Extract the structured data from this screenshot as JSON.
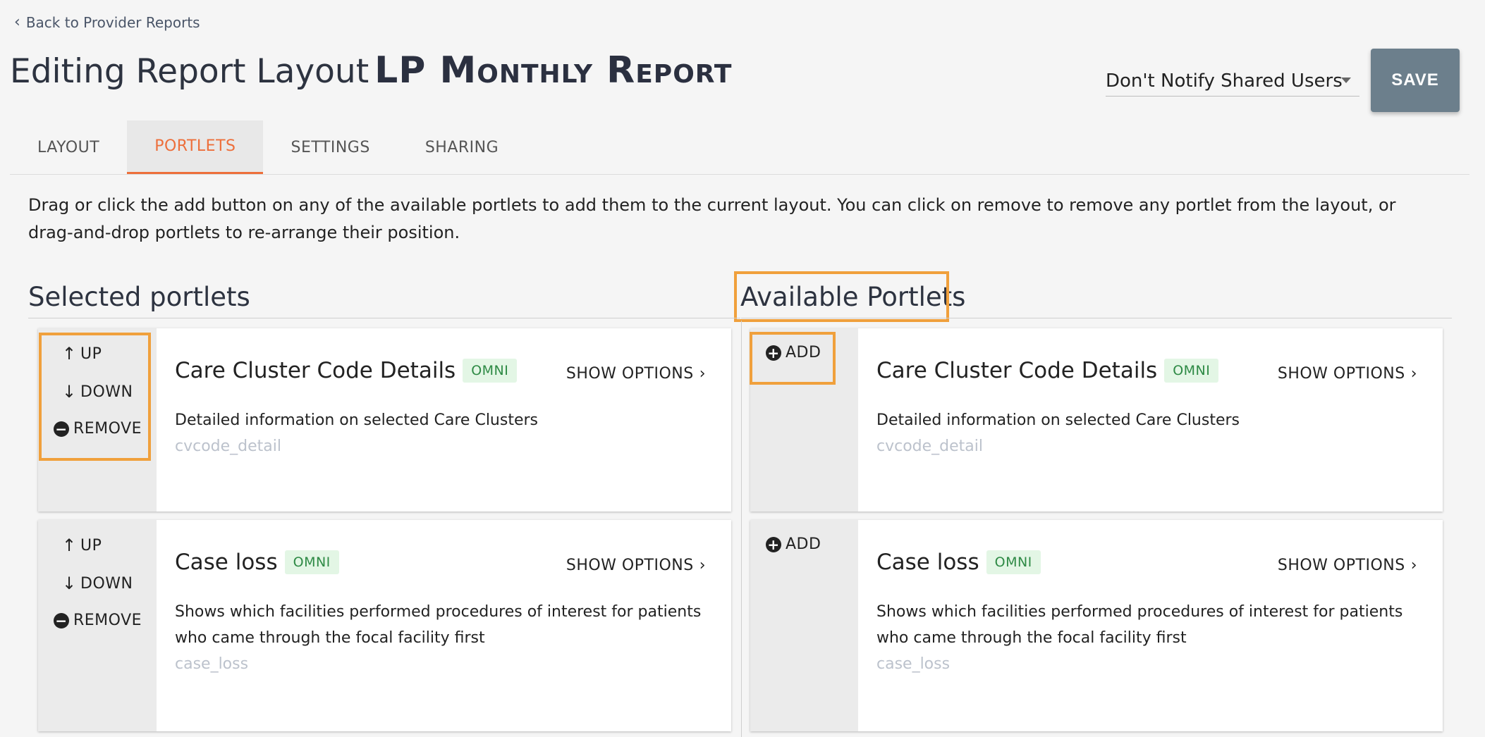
{
  "back_link": {
    "label": "Back to Provider Reports",
    "icon": "chevron-left-icon"
  },
  "page_title": {
    "prefix": "Editing Report Layout",
    "report_name": "LP Monthly Report"
  },
  "notify_select": {
    "value": "Don't Notify Shared Users"
  },
  "save_button": {
    "label": "SAVE"
  },
  "tabs": [
    {
      "label": "LAYOUT",
      "active": false
    },
    {
      "label": "PORTLETS",
      "active": true
    },
    {
      "label": "SETTINGS",
      "active": false
    },
    {
      "label": "SHARING",
      "active": false
    }
  ],
  "description": "Drag or click the add button on any of the available portlets to add them to the current layout. You can click on remove to remove any portlet from the layout, or drag-and-drop portlets to re-arrange their position.",
  "selected": {
    "heading": "Selected portlets",
    "controls": {
      "up": "UP",
      "down": "DOWN",
      "remove": "REMOVE"
    },
    "portlets": [
      {
        "title": "Care Cluster Code Details",
        "badge": "OMNI",
        "show_options": "SHOW OPTIONS",
        "description": "Detailed information on selected Care Clusters",
        "code": "cvcode_detail"
      },
      {
        "title": "Case loss",
        "badge": "OMNI",
        "show_options": "SHOW OPTIONS",
        "description": "Shows which facilities performed procedures of interest for patients who came through the focal facility first",
        "code": "case_loss"
      }
    ]
  },
  "available": {
    "heading": "Available Portlets",
    "controls": {
      "add": "ADD"
    },
    "portlets": [
      {
        "title": "Care Cluster Code Details",
        "badge": "OMNI",
        "show_options": "SHOW OPTIONS",
        "description": "Detailed information on selected Care Clusters",
        "code": "cvcode_detail"
      },
      {
        "title": "Case loss",
        "badge": "OMNI",
        "show_options": "SHOW OPTIONS",
        "description": "Shows which facilities performed procedures of interest for patients who came through the focal facility first",
        "code": "case_loss"
      }
    ]
  },
  "colors": {
    "accent": "#ed6f3b",
    "highlight_box": "#f0a03c",
    "save_button": "#6c7f8c",
    "badge_bg": "#e3f6e5",
    "badge_text": "#2e8a45"
  }
}
